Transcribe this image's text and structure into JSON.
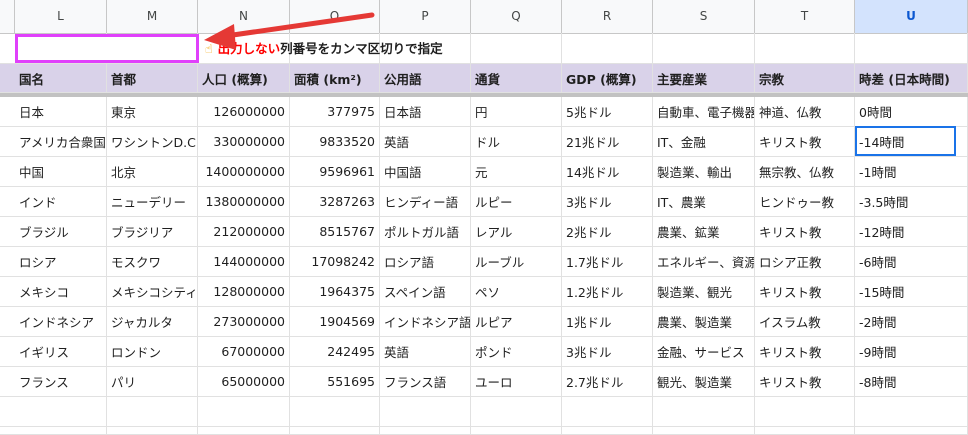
{
  "columns": [
    "L",
    "M",
    "N",
    "O",
    "P",
    "Q",
    "R",
    "S",
    "T",
    "U"
  ],
  "selected_column": "U",
  "note": {
    "hand_icon": "☝",
    "red_text": "出力しない",
    "text": "列番号をカンマ区切りで指定"
  },
  "headers": [
    "国名",
    "首都",
    "人口 (概算)",
    "面積 (km²)",
    "公用語",
    "通貨",
    "GDP (概算)",
    "主要産業",
    "宗教",
    "時差 (日本時間)"
  ],
  "rows": [
    [
      "日本",
      "東京",
      "126000000",
      "377975",
      "日本語",
      "円",
      "5兆ドル",
      "自動車、電子機器",
      "神道、仏教",
      "0時間"
    ],
    [
      "アメリカ合衆国",
      "ワシントンD.C.",
      "330000000",
      "9833520",
      "英語",
      "ドル",
      "21兆ドル",
      "IT、金融",
      "キリスト教",
      "-14時間"
    ],
    [
      "中国",
      "北京",
      "1400000000",
      "9596961",
      "中国語",
      "元",
      "14兆ドル",
      "製造業、輸出",
      "無宗教、仏教",
      "-1時間"
    ],
    [
      "インド",
      "ニューデリー",
      "1380000000",
      "3287263",
      "ヒンディー語",
      "ルピー",
      "3兆ドル",
      "IT、農業",
      "ヒンドゥー教",
      "-3.5時間"
    ],
    [
      "ブラジル",
      "ブラジリア",
      "212000000",
      "8515767",
      "ポルトガル語",
      "レアル",
      "2兆ドル",
      "農業、鉱業",
      "キリスト教",
      "-12時間"
    ],
    [
      "ロシア",
      "モスクワ",
      "144000000",
      "17098242",
      "ロシア語",
      "ルーブル",
      "1.7兆ドル",
      "エネルギー、資源",
      "ロシア正教",
      "-6時間"
    ],
    [
      "メキシコ",
      "メキシコシティ",
      "128000000",
      "1964375",
      "スペイン語",
      "ペソ",
      "1.2兆ドル",
      "製造業、観光",
      "キリスト教",
      "-15時間"
    ],
    [
      "インドネシア",
      "ジャカルタ",
      "273000000",
      "1904569",
      "インドネシア語",
      "ルピア",
      "1兆ドル",
      "農業、製造業",
      "イスラム教",
      "-2時間"
    ],
    [
      "イギリス",
      "ロンドン",
      "67000000",
      "242495",
      "英語",
      "ポンド",
      "3兆ドル",
      "金融、サービス",
      "キリスト教",
      "-9時間"
    ],
    [
      "フランス",
      "パリ",
      "65000000",
      "551695",
      "フランス語",
      "ユーロ",
      "2.7兆ドル",
      "観光、製造業",
      "キリスト教",
      "-8時間"
    ]
  ],
  "colors": {
    "header_fill": "#d9d2e9",
    "input_border": "#e040fb",
    "arrow": "#e53935",
    "selection": "#1a73e8"
  }
}
